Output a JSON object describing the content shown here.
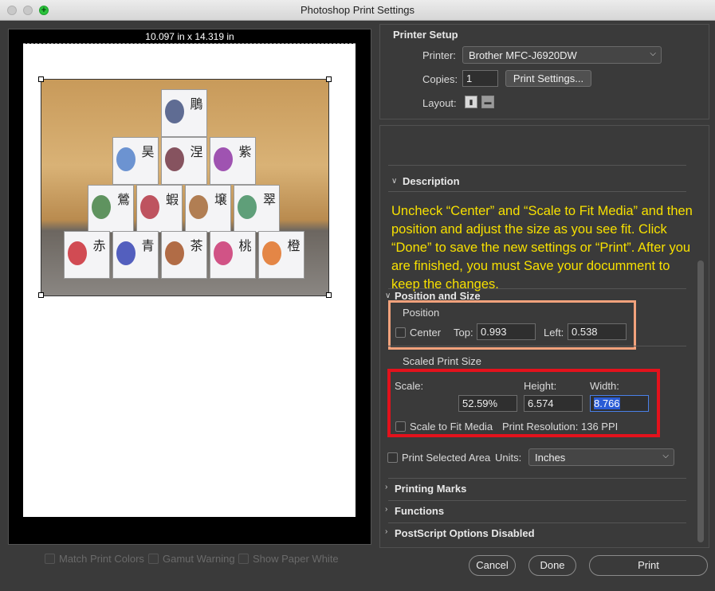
{
  "window": {
    "title": "Photoshop Print Settings"
  },
  "preview": {
    "dimensions": "10.097 in x 14.319 in",
    "boxes": [
      {
        "kanji": "鵰",
        "color": "#3a4a7a"
      },
      {
        "kanji": "昊",
        "color": "#4a7ac8"
      },
      {
        "kanji": "涅",
        "color": "#6a2a3a"
      },
      {
        "kanji": "紫",
        "color": "#8a2aa0"
      },
      {
        "kanji": "鶯",
        "color": "#3a7a3a"
      },
      {
        "kanji": "蝦",
        "color": "#b02a3a"
      },
      {
        "kanji": "壌",
        "color": "#a0602a"
      },
      {
        "kanji": "翠",
        "color": "#3a8a5a"
      },
      {
        "kanji": "赤",
        "color": "#c8202a"
      },
      {
        "kanji": "青",
        "color": "#2a3ab0"
      },
      {
        "kanji": "茶",
        "color": "#a04a1a"
      },
      {
        "kanji": "桃",
        "color": "#c82a6a"
      },
      {
        "kanji": "橙",
        "color": "#e06a1a"
      }
    ]
  },
  "bottom_checks": {
    "match_print_colors": "Match Print Colors",
    "gamut_warning": "Gamut Warning",
    "show_paper_white": "Show Paper White"
  },
  "printer_setup": {
    "title": "Printer Setup",
    "printer_label": "Printer:",
    "printer_value": "Brother MFC-J6920DW",
    "copies_label": "Copies:",
    "copies_value": "1",
    "print_settings_button": "Print Settings...",
    "layout_label": "Layout:"
  },
  "description": {
    "title": "Description",
    "text": "Uncheck “Center” and “Scale to Fit Media” and then position and adjust the size as you see fit.  Click “Done” to save the new settings or “Print”. After you are finished, you must Save your documment to keep the changes."
  },
  "position_size": {
    "title": "Position and Size",
    "position_title": "Position",
    "center_label": "Center",
    "center_checked": false,
    "top_label": "Top:",
    "top_value": "0.993",
    "left_label": "Left:",
    "left_value": "0.538",
    "scaled_title": "Scaled Print Size",
    "scale_label": "Scale:",
    "scale_value": "52.59%",
    "height_label": "Height:",
    "height_value": "6.574",
    "width_label": "Width:",
    "width_value": "8.766",
    "scale_to_fit_label": "Scale to Fit Media",
    "scale_to_fit_checked": false,
    "print_resolution": "Print Resolution: 136 PPI",
    "print_selected_area": "Print Selected Area",
    "units_label": "Units:",
    "units_value": "Inches"
  },
  "sections": {
    "printing_marks": "Printing Marks",
    "functions": "Functions",
    "postscript": "PostScript Options Disabled"
  },
  "buttons": {
    "cancel": "Cancel",
    "done": "Done",
    "print": "Print"
  },
  "colors": {
    "description_text": "#f7e000",
    "position_highlight": "#f2a27c",
    "scaled_highlight": "#e3121c"
  }
}
